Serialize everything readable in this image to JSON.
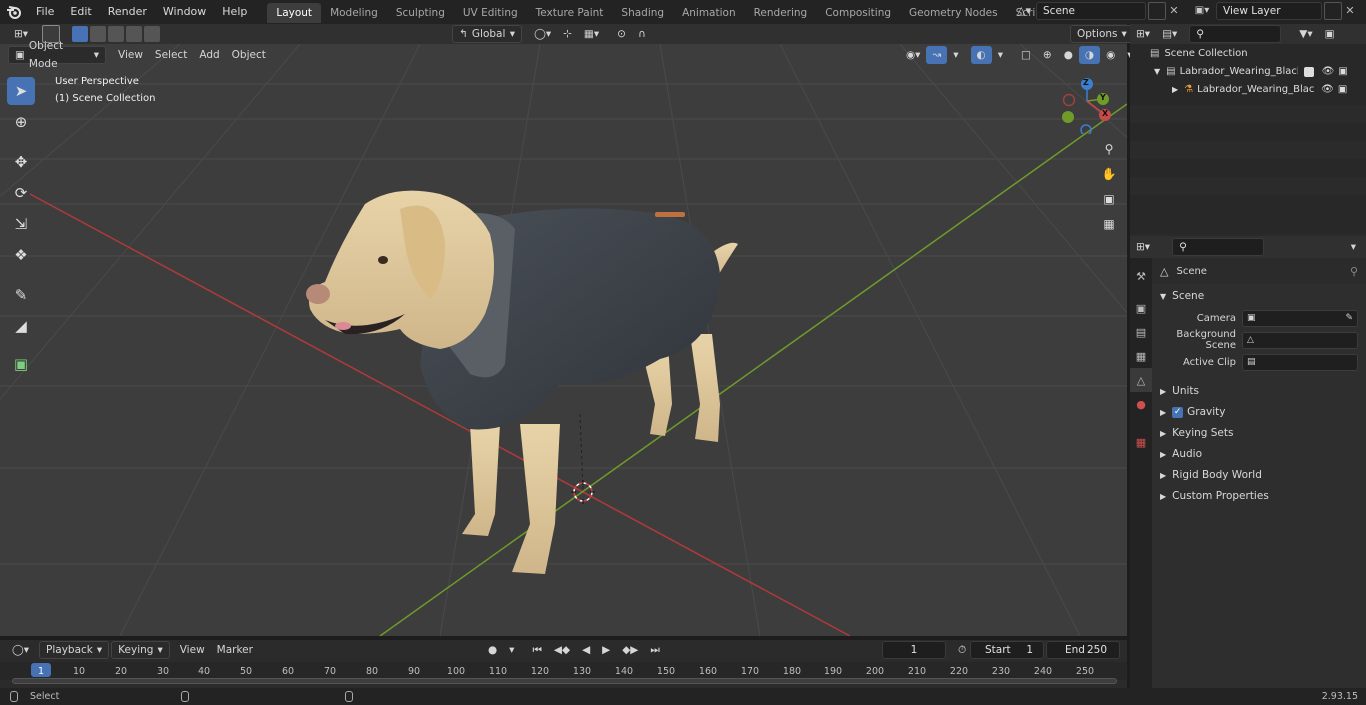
{
  "menu": [
    "File",
    "Edit",
    "Render",
    "Window",
    "Help"
  ],
  "workspaces": [
    "Layout",
    "Modeling",
    "Sculpting",
    "UV Editing",
    "Texture Paint",
    "Shading",
    "Animation",
    "Rendering",
    "Compositing",
    "Geometry Nodes",
    "Scripting"
  ],
  "active_workspace": "Layout",
  "scene_name": "Scene",
  "view_layer": "View Layer",
  "viewport_header": {
    "mode": "Object Mode",
    "menus": [
      "View",
      "Select",
      "Add",
      "Object"
    ],
    "transform_orientation": "Global",
    "options_label": "Options"
  },
  "viewport_overlay": {
    "perspective": "User Perspective",
    "collection": "(1) Scene Collection"
  },
  "gizmo": {
    "x": "X",
    "y": "Y",
    "z": "Z"
  },
  "outliner": {
    "root": "Scene Collection",
    "items": [
      "Labrador_Wearing_Black_Coa",
      "Labrador_Wearing_Black"
    ]
  },
  "properties": {
    "header": "Scene",
    "section": "Scene",
    "fields": [
      {
        "label": "Camera",
        "value": ""
      },
      {
        "label": "Background Scene",
        "value": ""
      },
      {
        "label": "Active Clip",
        "value": ""
      }
    ],
    "panels": [
      "Units",
      "Gravity",
      "Keying Sets",
      "Audio",
      "Rigid Body World",
      "Custom Properties"
    ],
    "gravity_checked": true
  },
  "timeline": {
    "menus": [
      "Playback",
      "Keying",
      "View",
      "Marker"
    ],
    "current_frame": "1",
    "start_label": "Start",
    "start": "1",
    "end_label": "End",
    "end": "250",
    "ticks": [
      "1",
      "10",
      "20",
      "30",
      "40",
      "50",
      "60",
      "70",
      "80",
      "90",
      "100",
      "110",
      "120",
      "130",
      "140",
      "150",
      "160",
      "170",
      "180",
      "190",
      "200",
      "210",
      "220",
      "230",
      "240",
      "250"
    ]
  },
  "status": {
    "select_label": "Select",
    "version": "2.93.15"
  },
  "colors": {
    "accent": "#4772b3",
    "x_axis": "#b03a3a",
    "y_axis": "#6f9b2a",
    "viewport_bg": "#3d3d3d"
  }
}
